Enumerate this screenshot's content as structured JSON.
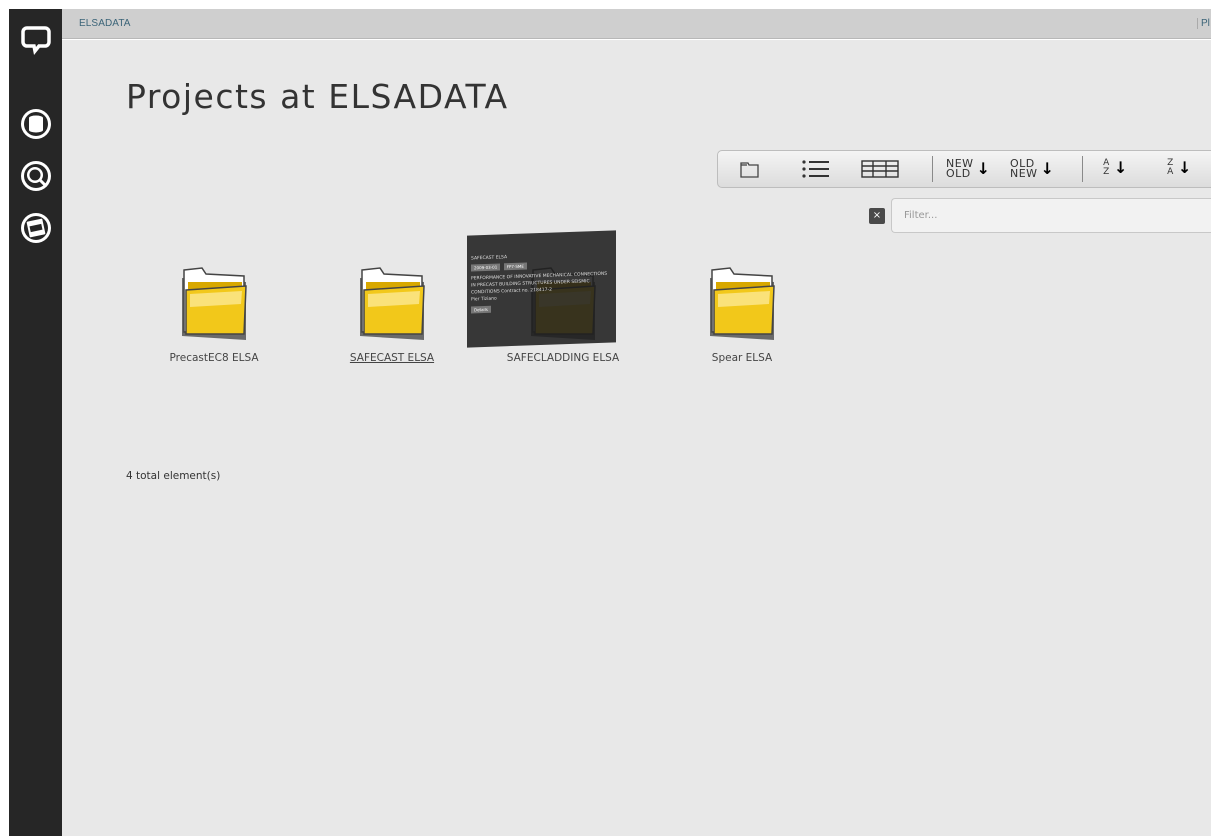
{
  "breadcrumb": {
    "root": "ELSADATA",
    "right_clip": "Pl"
  },
  "page": {
    "title": "Projects at ELSADATA"
  },
  "toolbar": {
    "sort_new_old_top": "NEW",
    "sort_new_old_bottom": "OLD",
    "sort_old_new_top": "OLD",
    "sort_old_new_bottom": "NEW",
    "az_top": "A",
    "az_bottom": "Z",
    "za_top": "Z",
    "za_bottom": "A"
  },
  "filter": {
    "placeholder": "Filter...",
    "clear": "×"
  },
  "folders": [
    {
      "label": "PrecastEC8 ELSA"
    },
    {
      "label": "SAFECAST ELSA"
    },
    {
      "label": "SAFECLADDING ELSA"
    },
    {
      "label": "Spear ELSA"
    }
  ],
  "tooltip": {
    "title": "SAFECAST ELSA",
    "chip1": "2009-03-01",
    "chip2": "FP7-SME",
    "body": "PERFORMANCE OF INNOVATIVE MECHANICAL CONNECTIONS IN PRECAST BUILDING STRUCTURES UNDER SEISMIC CONDITIONS Contract no. 218417-2",
    "author": "Pier Tiziano",
    "badge": "Details"
  },
  "footer": {
    "total": "4 total element(s)"
  },
  "colors": {
    "sidebar": "#262626",
    "topbar": "#cfcfcf",
    "content_bg": "#e8e8e8",
    "folder": "#f2c81a",
    "crumb": "#3b6478"
  }
}
